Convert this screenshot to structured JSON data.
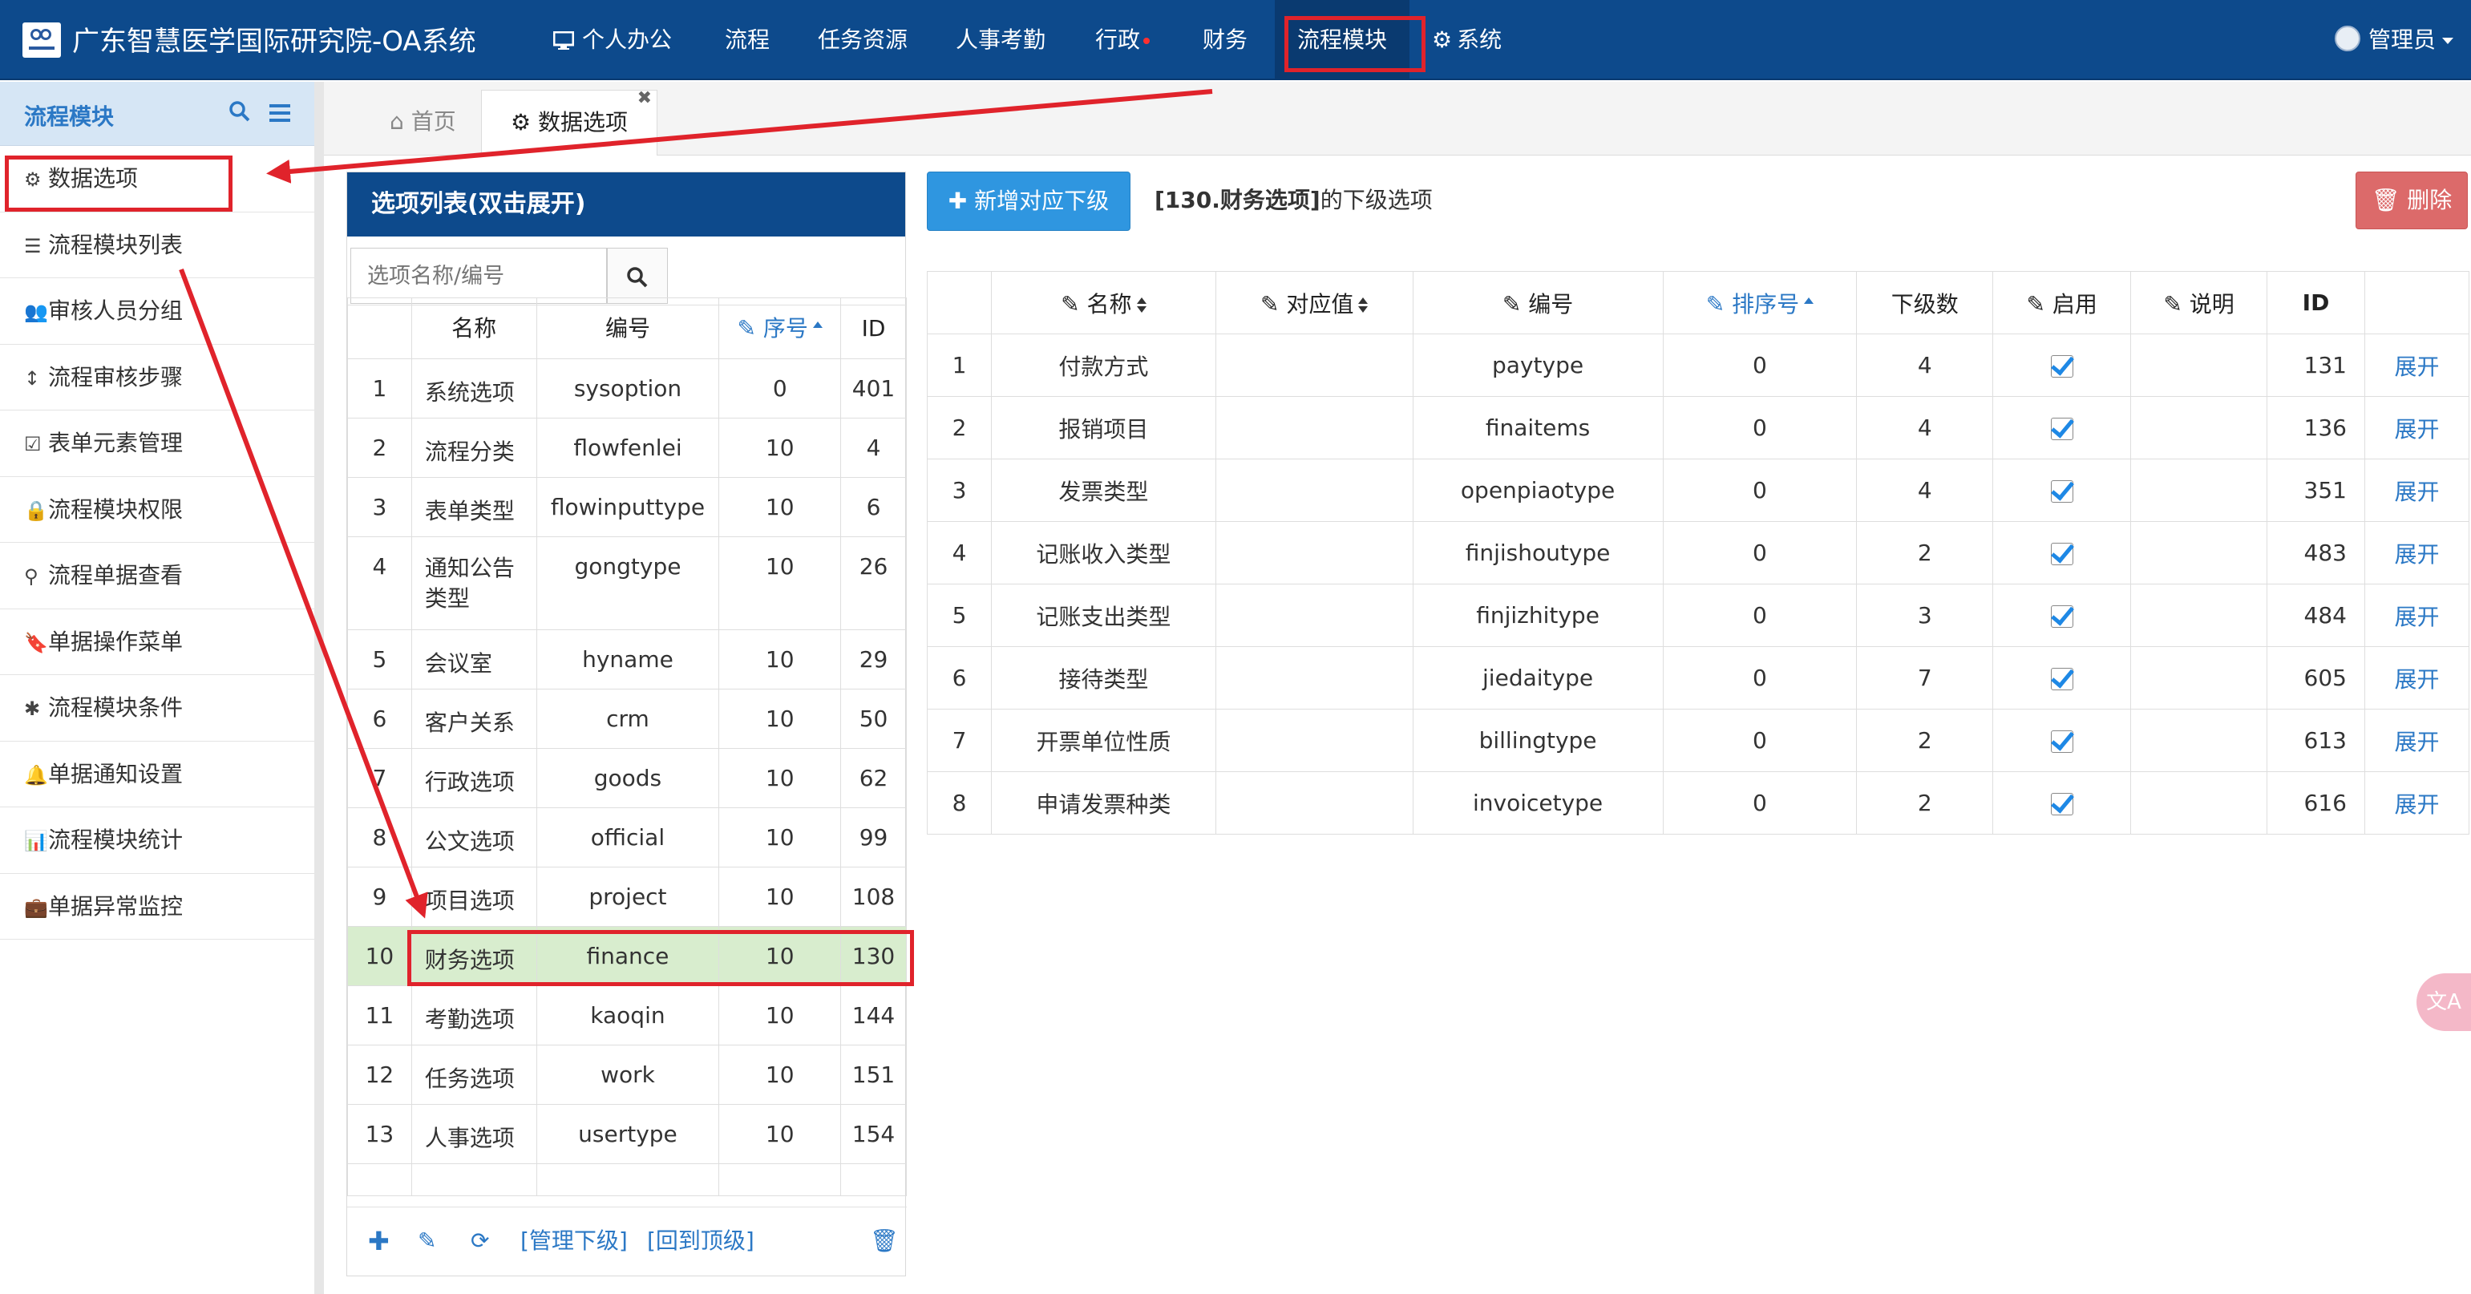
{
  "app": {
    "title": "广东智慧医学国际研究院-OA系统"
  },
  "nav": {
    "items": [
      {
        "label": "个人办公",
        "icon": "monitor-icon"
      },
      {
        "label": "流程"
      },
      {
        "label": "任务资源"
      },
      {
        "label": "人事考勤"
      },
      {
        "label": "行政",
        "has_dot": true
      },
      {
        "label": "财务"
      },
      {
        "label": "流程模块",
        "active": true
      },
      {
        "label": "系统",
        "icon": "gear-icon"
      }
    ],
    "user": "管理员"
  },
  "sidebar": {
    "title": "流程模块",
    "items": [
      {
        "label": "数据选项",
        "icon": "gear-icon"
      },
      {
        "label": "流程模块列表",
        "icon": "list-icon"
      },
      {
        "label": "审核人员分组",
        "icon": "users-icon"
      },
      {
        "label": "流程审核步骤",
        "icon": "vertical-arrows-icon"
      },
      {
        "label": "表单元素管理",
        "icon": "checkbox-icon"
      },
      {
        "label": "流程模块权限",
        "icon": "lock-icon"
      },
      {
        "label": "流程单据查看",
        "icon": "search-icon"
      },
      {
        "label": "单据操作菜单",
        "icon": "bookmark-icon"
      },
      {
        "label": "流程模块条件",
        "icon": "asterisk-icon"
      },
      {
        "label": "单据通知设置",
        "icon": "bell-icon"
      },
      {
        "label": "流程模块统计",
        "icon": "bar-chart-icon"
      },
      {
        "label": "单据异常监控",
        "icon": "briefcase-icon"
      }
    ]
  },
  "tabs": [
    {
      "label": "首页",
      "icon": "home-icon"
    },
    {
      "label": "数据选项",
      "icon": "gear-icon",
      "active": true
    }
  ],
  "options_panel": {
    "title": "选项列表(双击展开)",
    "search_placeholder": "选项名称/编号",
    "columns": [
      "",
      "名称",
      "编号",
      "序号",
      "ID"
    ],
    "rows": [
      {
        "n": "1",
        "name": "系统选项",
        "code": "sysoption",
        "sort": "0",
        "id": "401"
      },
      {
        "n": "2",
        "name": "流程分类",
        "code": "flowfenlei",
        "sort": "10",
        "id": "4"
      },
      {
        "n": "3",
        "name": "表单类型",
        "code": "flowinputtype",
        "sort": "10",
        "id": "6"
      },
      {
        "n": "4",
        "name": "通知公告类型",
        "code": "gongtype",
        "sort": "10",
        "id": "26"
      },
      {
        "n": "5",
        "name": "会议室",
        "code": "hyname",
        "sort": "10",
        "id": "29"
      },
      {
        "n": "6",
        "name": "客户关系",
        "code": "crm",
        "sort": "10",
        "id": "50"
      },
      {
        "n": "7",
        "name": "行政选项",
        "code": "goods",
        "sort": "10",
        "id": "62"
      },
      {
        "n": "8",
        "name": "公文选项",
        "code": "official",
        "sort": "10",
        "id": "99"
      },
      {
        "n": "9",
        "name": "项目选项",
        "code": "project",
        "sort": "10",
        "id": "108"
      },
      {
        "n": "10",
        "name": "财务选项",
        "code": "finance",
        "sort": "10",
        "id": "130",
        "selected": true
      },
      {
        "n": "11",
        "name": "考勤选项",
        "code": "kaoqin",
        "sort": "10",
        "id": "144"
      },
      {
        "n": "12",
        "name": "任务选项",
        "code": "work",
        "sort": "10",
        "id": "151"
      },
      {
        "n": "13",
        "name": "人事选项",
        "code": "usertype",
        "sort": "10",
        "id": "154"
      }
    ],
    "footer": {
      "manage_label": "[管理下级]",
      "back_label": "[回到顶级]"
    }
  },
  "sub_panel": {
    "add_button": "新增对应下级",
    "heading_bold": "[130.财务选项]",
    "heading_rest": "的下级选项",
    "delete_button": "删除",
    "columns": [
      "",
      "名称",
      "对应值",
      "编号",
      "排序号",
      "下级数",
      "启用",
      "说明",
      "ID",
      ""
    ],
    "rows": [
      {
        "n": "1",
        "name": "付款方式",
        "value": "",
        "code": "paytype",
        "sort": "0",
        "children": "4",
        "enabled": true,
        "note": "",
        "id": "131",
        "action": "展开"
      },
      {
        "n": "2",
        "name": "报销项目",
        "value": "",
        "code": "finaitems",
        "sort": "0",
        "children": "4",
        "enabled": true,
        "note": "",
        "id": "136",
        "action": "展开"
      },
      {
        "n": "3",
        "name": "发票类型",
        "value": "",
        "code": "openpiaotype",
        "sort": "0",
        "children": "4",
        "enabled": true,
        "note": "",
        "id": "351",
        "action": "展开"
      },
      {
        "n": "4",
        "name": "记账收入类型",
        "value": "",
        "code": "finjishoutype",
        "sort": "0",
        "children": "2",
        "enabled": true,
        "note": "",
        "id": "483",
        "action": "展开"
      },
      {
        "n": "5",
        "name": "记账支出类型",
        "value": "",
        "code": "finjizhitype",
        "sort": "0",
        "children": "3",
        "enabled": true,
        "note": "",
        "id": "484",
        "action": "展开"
      },
      {
        "n": "6",
        "name": "接待类型",
        "value": "",
        "code": "jiedaitype",
        "sort": "0",
        "children": "7",
        "enabled": true,
        "note": "",
        "id": "605",
        "action": "展开"
      },
      {
        "n": "7",
        "name": "开票单位性质",
        "value": "",
        "code": "billingtype",
        "sort": "0",
        "children": "2",
        "enabled": true,
        "note": "",
        "id": "613",
        "action": "展开"
      },
      {
        "n": "8",
        "name": "申请发票种类",
        "value": "",
        "code": "invoicetype",
        "sort": "0",
        "children": "2",
        "enabled": true,
        "note": "",
        "id": "616",
        "action": "展开"
      }
    ]
  },
  "colors": {
    "navbar": "#0d4a8c",
    "accent": "#2b78c5",
    "add_button": "#2f96e0",
    "delete_button": "#dc6a6a",
    "selected_row": "#d8edce",
    "annotation_red": "#e0232b"
  }
}
